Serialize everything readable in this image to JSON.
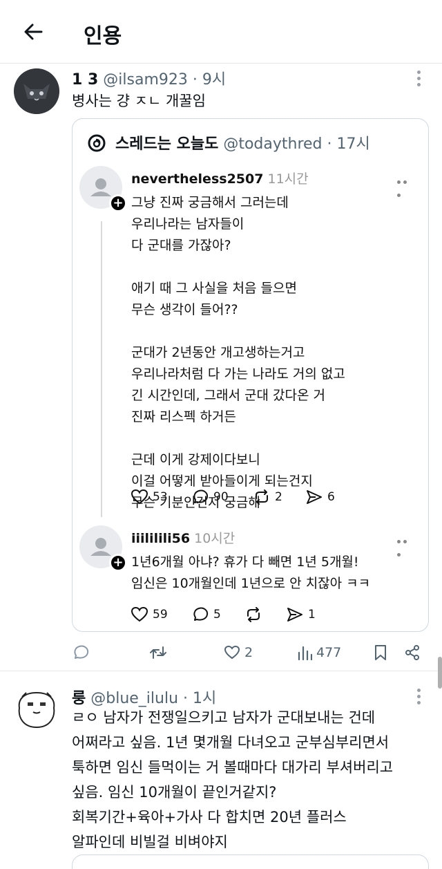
{
  "header": {
    "title": "인용"
  },
  "post1": {
    "name": "1 3",
    "handle": "@ilsam923",
    "time": "· 9시",
    "text": "병사는 걍 ㅈㄴ 개꿀임",
    "actions": {
      "views": "477",
      "quotes": "2"
    }
  },
  "quote": {
    "name": "스레드는 오늘도",
    "handle": "@todaythred",
    "time": "· 17시",
    "threads": [
      {
        "username": "nevertheless2507",
        "time": "11시간",
        "text": "그냥 진짜 궁금해서 그러는데\n우리나라는 남자들이\n다 군대를 가잖아?\n\n애기 때 그 사실을 처음 들으면\n무슨 생각이 들어??\n\n군대가 2년동안 개고생하는거고\n우리나라처럼 다 가는 나라도 거의 없고\n긴 시간인데, 그래서 군대 갔다온 거\n진짜 리스펙 하거든\n\n근데 이게 강제이다보니\n이걸 어떻게 받아들이게 되는건지\n무슨 기분인건지 궁금해",
        "likes": "53",
        "replies": "90",
        "reposts": "2",
        "shares": "6"
      },
      {
        "username": "iiililili56",
        "time": "10시간",
        "text": "1년6개월 아냐? 휴가 다 빼면 1년 5개월!\n임신은 10개월인데 1년으로 안 치잖아 ㅋㅋ",
        "likes": "59",
        "replies": "5",
        "shares": "1"
      }
    ]
  },
  "post2": {
    "name": "룽",
    "handle": "@blue_ilulu",
    "time": "· 1시",
    "text": "ㄹㅇ 남자가 전쟁일으키고 남자가 군대보내는 건데\n어쩌라고 싶음. 1년 몇개월 다녀오고 군부심부리면서\n툭하면 임신 들먹이는 거 볼때마다 대가리 부셔버리고\n싶음. 임신 10개월이 끝인거같지?\n회복기간+육아+가사 다 합치면 20년 플러스\n알파인데 비빌걸 비벼야지"
  }
}
